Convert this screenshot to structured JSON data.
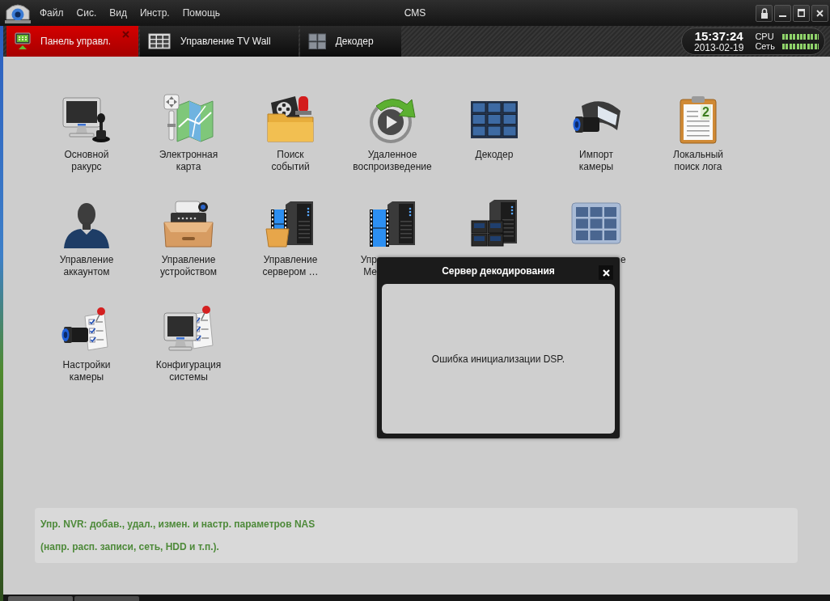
{
  "window": {
    "title": "CMS"
  },
  "menu": [
    "Файл",
    "Сис.",
    "Вид",
    "Инстр.",
    "Помощь"
  ],
  "tabs": [
    {
      "label": "Панель управл.",
      "kind": "monitor",
      "selected": true,
      "closable": true
    },
    {
      "label": "Управление TV Wall",
      "kind": "grid",
      "selected": false,
      "closable": false
    },
    {
      "label": "Декодер",
      "kind": "tiles",
      "selected": false,
      "closable": false
    }
  ],
  "status": {
    "time": "15:37:24",
    "date": "2013-02-19",
    "meters": [
      {
        "label": "CPU",
        "level": 1
      },
      {
        "label": "Сеть",
        "level": 1
      }
    ]
  },
  "module_rows": [
    [
      {
        "kind": "monitor_joystick",
        "label": [
          "Основной",
          "ракурс"
        ]
      },
      {
        "kind": "map",
        "label": [
          "Электронная",
          "карта"
        ]
      },
      {
        "kind": "folder_reel",
        "label": [
          "Поиск",
          "событий"
        ]
      },
      {
        "kind": "play_circle",
        "label": [
          "Удаленное",
          "воспроизведение"
        ]
      },
      {
        "kind": "monitor_wall",
        "label": [
          "Декодер"
        ]
      },
      {
        "kind": "camera_film",
        "label": [
          "Импорт",
          "камеры"
        ]
      },
      {
        "kind": "clipboard",
        "icon_text": "2",
        "label": [
          "Локальный",
          "поиск лога"
        ]
      }
    ],
    [
      {
        "kind": "person",
        "label": [
          "Управление",
          "аккаунтом"
        ]
      },
      {
        "kind": "device_tray",
        "label": [
          "Управление",
          "устройством"
        ]
      },
      {
        "kind": "server_film_tray",
        "label": [
          "Управление",
          "сервером  …"
        ]
      },
      {
        "kind": "server_film",
        "label": [
          "Упр",
          "Ме"
        ],
        "covered_right": true
      },
      {
        "kind": "server_drives"
      },
      {
        "kind": "grid_panel",
        "label": [
          "е"
        ],
        "covered_left": true
      }
    ],
    [
      {
        "kind": "camera_checklist",
        "label": [
          "Настройки",
          "камеры"
        ]
      },
      {
        "kind": "monitor_checklist",
        "label": [
          "Конфигурация",
          "системы"
        ]
      }
    ]
  ],
  "dialog": {
    "title": "Сервер декодирования",
    "message": "Ошибка инициализации DSP."
  },
  "description": [
    "Упр. NVR: добав., удал., измен. и настр. параметров NAS",
    "(напр. расп. записи, сеть, HDD и т.п.)."
  ]
}
